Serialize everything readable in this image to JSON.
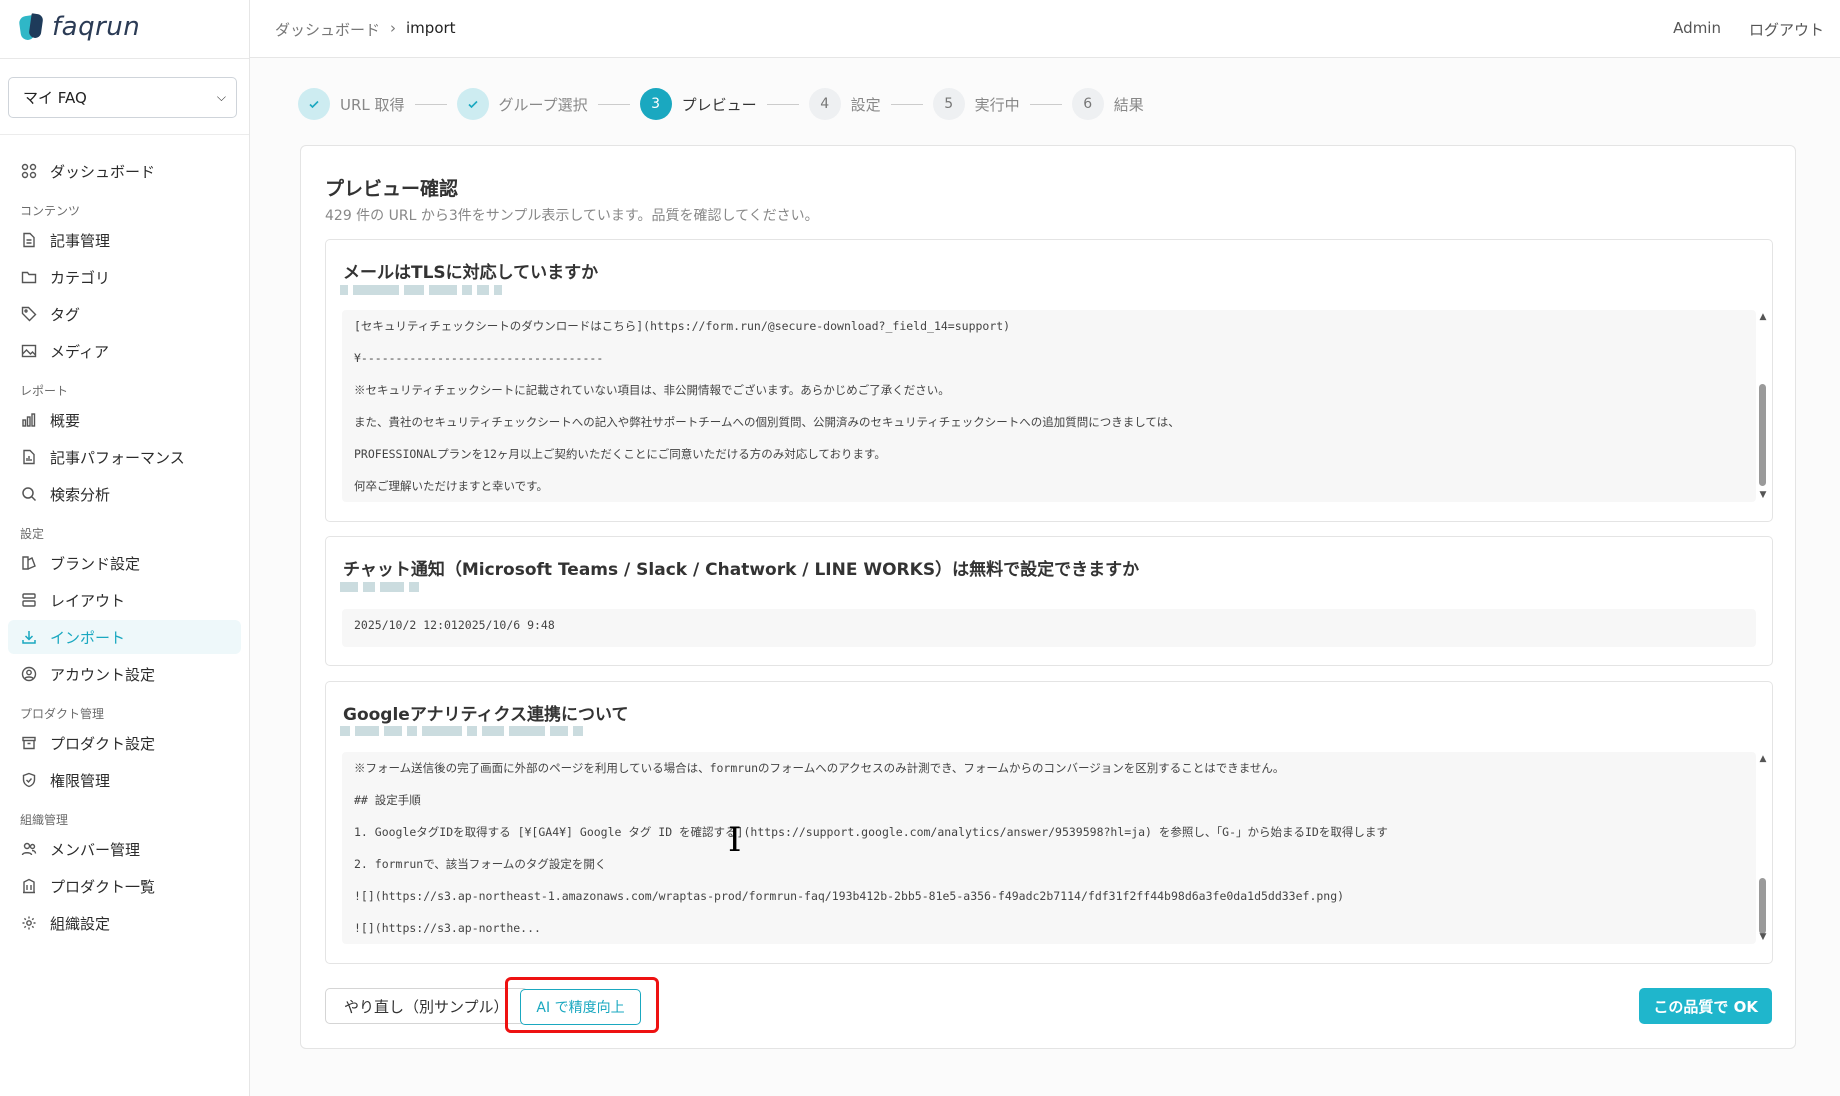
{
  "app": {
    "logo_text": "faqrun"
  },
  "sidebar": {
    "faq_select": "マイ FAQ",
    "items": [
      {
        "type": "item",
        "label": "ダッシュボード",
        "icon": "grid-icon"
      },
      {
        "type": "section",
        "label": "コンテンツ"
      },
      {
        "type": "item",
        "label": "記事管理",
        "icon": "document-icon"
      },
      {
        "type": "item",
        "label": "カテゴリ",
        "icon": "folder-icon"
      },
      {
        "type": "item",
        "label": "タグ",
        "icon": "tag-icon"
      },
      {
        "type": "item",
        "label": "メディア",
        "icon": "image-icon"
      },
      {
        "type": "section",
        "label": "レポート"
      },
      {
        "type": "item",
        "label": "概要",
        "icon": "bar-chart-icon"
      },
      {
        "type": "item",
        "label": "記事パフォーマンス",
        "icon": "document-chart-icon"
      },
      {
        "type": "item",
        "label": "検索分析",
        "icon": "search-icon"
      },
      {
        "type": "section",
        "label": "設定"
      },
      {
        "type": "item",
        "label": "ブランド設定",
        "icon": "palette-icon"
      },
      {
        "type": "item",
        "label": "レイアウト",
        "icon": "layout-icon"
      },
      {
        "type": "item",
        "label": "インポート",
        "icon": "download-icon",
        "active": true
      },
      {
        "type": "item",
        "label": "アカウント設定",
        "icon": "user-circle-icon"
      },
      {
        "type": "section",
        "label": "プロダクト管理"
      },
      {
        "type": "item",
        "label": "プロダクト設定",
        "icon": "box-icon"
      },
      {
        "type": "item",
        "label": "権限管理",
        "icon": "shield-icon"
      },
      {
        "type": "section",
        "label": "組織管理"
      },
      {
        "type": "item",
        "label": "メンバー管理",
        "icon": "users-icon"
      },
      {
        "type": "item",
        "label": "プロダクト一覧",
        "icon": "building-icon"
      },
      {
        "type": "item",
        "label": "組織設定",
        "icon": "gear-icon"
      }
    ]
  },
  "header": {
    "breadcrumb": [
      "ダッシュボード",
      "import"
    ],
    "admin": "Admin",
    "logout": "ログアウト"
  },
  "stepper": [
    {
      "num": "",
      "label": "URL 取得",
      "state": "done"
    },
    {
      "num": "",
      "label": "グループ選択",
      "state": "done"
    },
    {
      "num": "3",
      "label": "プレビュー",
      "state": "cur"
    },
    {
      "num": "4",
      "label": "設定",
      "state": "todo"
    },
    {
      "num": "5",
      "label": "実行中",
      "state": "todo"
    },
    {
      "num": "6",
      "label": "結果",
      "state": "todo"
    }
  ],
  "preview": {
    "title": "プレビュー確認",
    "subtitle": "429 件の URL から3件をサンプル表示しています。品質を確認してください。",
    "items": [
      {
        "question": "メールはTLSに対応していますか",
        "lines": [
          "[セキュリティチェックシートのダウンロードはこちら](https://form.run/@secure-download?_field_14=support)",
          "¥-----------------------------------",
          "※セキュリティチェックシートに記載されていない項目は、非公開情報でございます。あらかじめご了承ください。",
          "また、貴社のセキュリティチェックシートへの記入や弊社サポートチームへの個別質問、公開済みのセキュリティチェックシートへの追加質問につきましては、",
          "PROFESSIONALプランを12ヶ月以上ご契約いただくことにご同意いただける方のみ対応しております。",
          "何卒ご理解いただけますと幸いです。"
        ]
      },
      {
        "question": "チャット通知（Microsoft Teams / Slack / Chatwork / LINE WORKS）は無料で設定できますか",
        "lines": [
          "2025/10/2 12:012025/10/6 9:48"
        ]
      },
      {
        "question": "Googleアナリティクス連携について",
        "lines": [
          "※フォーム送信後の完了画面に外部のページを利用している場合は、formrunのフォームへのアクセスのみ計測でき、フォームからのコンバージョンを区別することはできません。",
          "## 設定手順",
          "1.  GoogleタグIDを取得する [¥[GA4¥] Google タグ ID を確認する](https://support.google.com/analytics/answer/9539598?hl=ja) を参照し、「G-」から始まるIDを取得します",
          "2.  formrunで、該当フォームのタグ設定を開く",
          "![](https://s3.ap-northeast-1.amazonaws.com/wraptas-prod/formrun-faq/193b412b-2bb5-81e5-a356-f49adc2b7114/fdf31f2ff44b98d6a3fe0da1d5dd33ef.png)",
          "![](https://s3.ap-northe..."
        ]
      }
    ]
  },
  "buttons": {
    "retry": "やり直し（別サンプル）",
    "ai": "AI で精度向上",
    "ok": "この品質で OK"
  },
  "colors": {
    "accent": "#1aa8c0",
    "highlight": "#e11111"
  }
}
